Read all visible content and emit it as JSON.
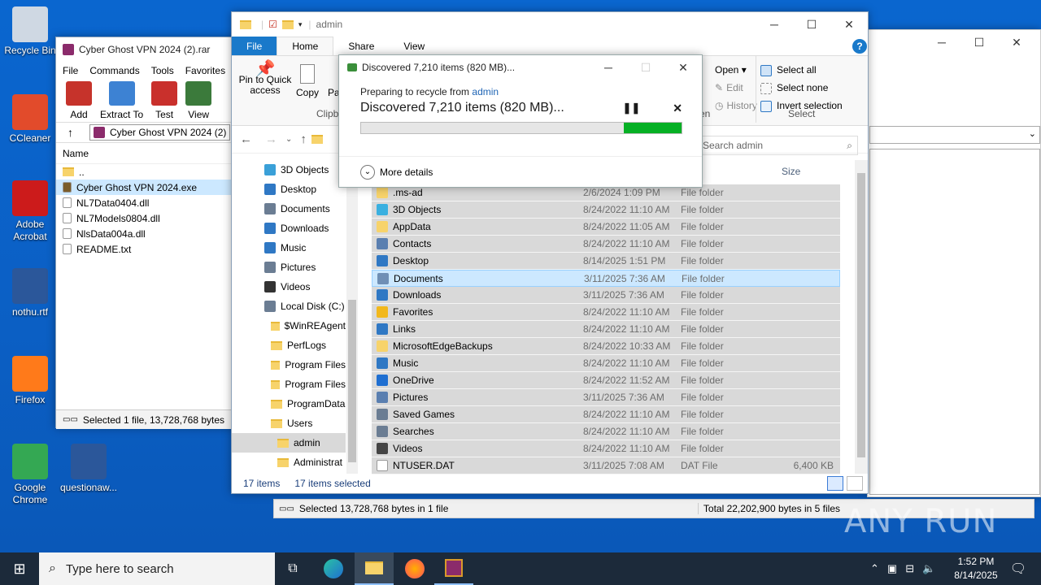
{
  "desktop": {
    "icons": [
      {
        "label": "Recycle Bin",
        "color": "#cfd8e3"
      },
      {
        "label": "CCleaner",
        "color": "#e24b2b"
      },
      {
        "label": "Adobe Acrobat",
        "color": "#cc1b1b"
      },
      {
        "label": "nothu.rtf",
        "color": "#2b579a"
      },
      {
        "label": "Firefox",
        "color": "#ff7a1a"
      },
      {
        "label": "Google Chrome",
        "color": "#34a853"
      },
      {
        "label": "questionaw...",
        "color": "#2b579a"
      }
    ]
  },
  "winrar": {
    "title": "Cyber Ghost VPN 2024 (2).rar",
    "menu": [
      "File",
      "Commands",
      "Tools",
      "Favorites"
    ],
    "toolbar": [
      "Add",
      "Extract To",
      "Test",
      "View"
    ],
    "path": "Cyber Ghost VPN 2024 (2)",
    "column_name": "Name",
    "files": [
      "..",
      "Cyber Ghost VPN 2024.exe",
      "NL7Data0404.dll",
      "NL7Models0804.dll",
      "NlsData004a.dll",
      "README.txt"
    ],
    "status": "Selected 1 file, 13,728,768 bytes",
    "status_bottom_left": "Selected 13,728,768 bytes in 1 file",
    "status_bottom_right": "Total 22,202,900 bytes in 5 files"
  },
  "explorer": {
    "title": "admin",
    "tabs": [
      "File",
      "Home",
      "Share",
      "View"
    ],
    "ribbon": {
      "pin": "Pin to Quick access",
      "copy": "Copy",
      "paste_partial": "Pa",
      "clipboard_group": "Clipb",
      "open": "Open",
      "edit": "Edit",
      "history": "History",
      "open_group": "en",
      "select_all": "Select all",
      "select_none": "Select none",
      "invert_selection": "Invert selection",
      "select_group": "Select"
    },
    "search_placeholder": "Search admin",
    "column_size": "Size",
    "nav": [
      {
        "label": "3D Objects",
        "indent": 1
      },
      {
        "label": "Desktop",
        "indent": 1
      },
      {
        "label": "Documents",
        "indent": 1
      },
      {
        "label": "Downloads",
        "indent": 1
      },
      {
        "label": "Music",
        "indent": 1
      },
      {
        "label": "Pictures",
        "indent": 1
      },
      {
        "label": "Videos",
        "indent": 1
      },
      {
        "label": "Local Disk (C:)",
        "indent": 1
      },
      {
        "label": "$WinREAgent",
        "indent": 2
      },
      {
        "label": "PerfLogs",
        "indent": 2
      },
      {
        "label": "Program Files",
        "indent": 2
      },
      {
        "label": "Program Files",
        "indent": 2
      },
      {
        "label": "ProgramData",
        "indent": 2
      },
      {
        "label": "Users",
        "indent": 2
      },
      {
        "label": "admin",
        "indent": 3
      },
      {
        "label": "Administrat",
        "indent": 3
      }
    ],
    "files": [
      {
        "name": ".ms-ad",
        "date": "2/6/2024 1:09 PM",
        "type": "File folder",
        "size": ""
      },
      {
        "name": "3D Objects",
        "date": "8/24/2022 11:10 AM",
        "type": "File folder",
        "size": ""
      },
      {
        "name": "AppData",
        "date": "8/24/2022 11:05 AM",
        "type": "File folder",
        "size": ""
      },
      {
        "name": "Contacts",
        "date": "8/24/2022 11:10 AM",
        "type": "File folder",
        "size": ""
      },
      {
        "name": "Desktop",
        "date": "8/14/2025 1:51 PM",
        "type": "File folder",
        "size": ""
      },
      {
        "name": "Documents",
        "date": "3/11/2025 7:36 AM",
        "type": "File folder",
        "size": ""
      },
      {
        "name": "Downloads",
        "date": "3/11/2025 7:36 AM",
        "type": "File folder",
        "size": ""
      },
      {
        "name": "Favorites",
        "date": "8/24/2022 11:10 AM",
        "type": "File folder",
        "size": ""
      },
      {
        "name": "Links",
        "date": "8/24/2022 11:10 AM",
        "type": "File folder",
        "size": ""
      },
      {
        "name": "MicrosoftEdgeBackups",
        "date": "8/24/2022 10:33 AM",
        "type": "File folder",
        "size": ""
      },
      {
        "name": "Music",
        "date": "8/24/2022 11:10 AM",
        "type": "File folder",
        "size": ""
      },
      {
        "name": "OneDrive",
        "date": "8/24/2022 11:52 AM",
        "type": "File folder",
        "size": ""
      },
      {
        "name": "Pictures",
        "date": "3/11/2025 7:36 AM",
        "type": "File folder",
        "size": ""
      },
      {
        "name": "Saved Games",
        "date": "8/24/2022 11:10 AM",
        "type": "File folder",
        "size": ""
      },
      {
        "name": "Searches",
        "date": "8/24/2022 11:10 AM",
        "type": "File folder",
        "size": ""
      },
      {
        "name": "Videos",
        "date": "8/24/2022 11:10 AM",
        "type": "File folder",
        "size": ""
      },
      {
        "name": "NTUSER.DAT",
        "date": "3/11/2025 7:08 AM",
        "type": "DAT File",
        "size": "6,400 KB"
      }
    ],
    "status_count": "17 items",
    "status_selected": "17 items selected"
  },
  "dialog": {
    "title": "Discovered 7,210 items (820 MB)...",
    "preparing": "Preparing to recycle from",
    "source": "admin",
    "heading": "Discovered 7,210 items (820 MB)...",
    "progress_fraction": 0.82,
    "more_details": "More details"
  },
  "taskbar": {
    "search_placeholder": "Type here to search",
    "time": "1:52 PM",
    "date": "8/14/2025"
  },
  "watermark": "ANY RUN"
}
